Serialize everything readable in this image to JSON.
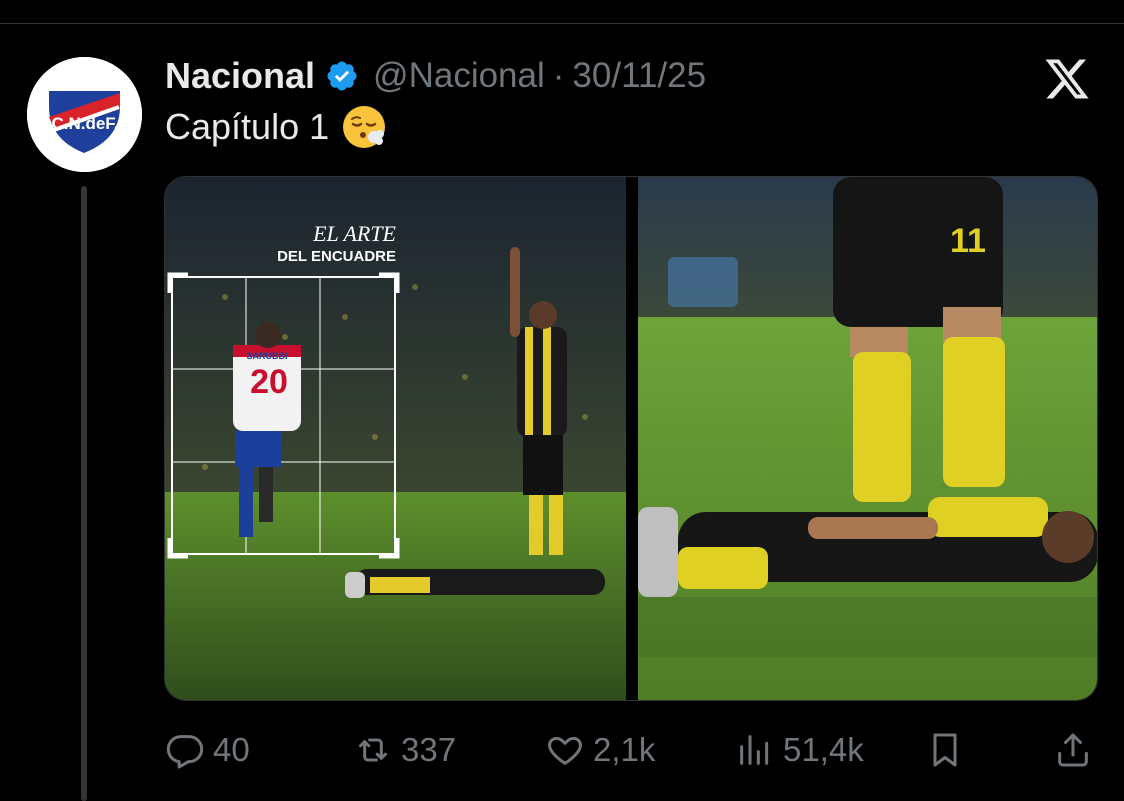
{
  "tweet": {
    "author_name": "Nacional",
    "handle": "@Nacional",
    "separator": "·",
    "date": "30/11/25",
    "text": "Capítulo 1",
    "avatar_logo_text": "C.N.deF."
  },
  "media": {
    "left_image": {
      "overlay_line1": "EL ARTE",
      "overlay_line2": "DEL ENCUADRE",
      "player_name": "SARUBBI",
      "player_number": "20"
    },
    "right_image": {
      "player_number": "11"
    }
  },
  "actions": {
    "replies": "40",
    "reposts": "337",
    "likes": "2,1k",
    "views": "51,4k"
  },
  "colors": {
    "background": "#000000",
    "text_primary": "#e7e9ea",
    "text_secondary": "#71767b",
    "verified_blue": "#1d9bf0"
  }
}
